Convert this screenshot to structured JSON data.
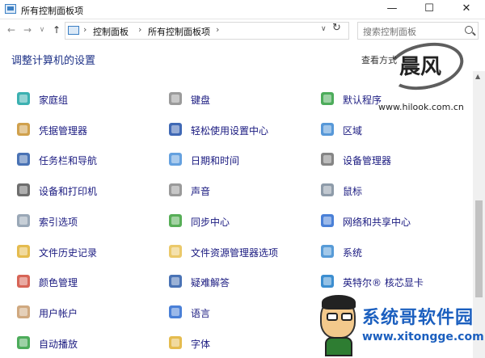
{
  "window": {
    "title": "所有控制面板项",
    "minimize_glyph": "—",
    "maximize_glyph": "☐",
    "close_glyph": "✕"
  },
  "nav": {
    "back_glyph": "←",
    "forward_glyph": "→",
    "recent_glyph": "∨",
    "up_glyph": "↑"
  },
  "address": {
    "crumbs": [
      "控制面板",
      "所有控制面板项"
    ],
    "separator": "›",
    "dropdown_glyph": "∨",
    "refresh_glyph": "↻"
  },
  "search": {
    "placeholder": "搜索控制面板"
  },
  "heading": "调整计算机的设置",
  "view_by": "查看方式",
  "items": [
    {
      "label": "家庭组",
      "icon": "homegroup-icon",
      "color": "#1aa3a3"
    },
    {
      "label": "键盘",
      "icon": "keyboard-icon",
      "color": "#8a8a8a"
    },
    {
      "label": "默认程序",
      "icon": "default-programs-icon",
      "color": "#2e9e3e"
    },
    {
      "label": "凭据管理器",
      "icon": "credential-manager-icon",
      "color": "#c8902e"
    },
    {
      "label": "轻松使用设置中心",
      "icon": "ease-of-access-icon",
      "color": "#1f4fa8"
    },
    {
      "label": "区域",
      "icon": "region-icon",
      "color": "#3a86d1"
    },
    {
      "label": "任务栏和导航",
      "icon": "taskbar-icon",
      "color": "#2a5aa8"
    },
    {
      "label": "日期和时间",
      "icon": "date-time-icon",
      "color": "#4a90d9"
    },
    {
      "label": "设备管理器",
      "icon": "device-manager-icon",
      "color": "#707070"
    },
    {
      "label": "设备和打印机",
      "icon": "printer-icon",
      "color": "#555555"
    },
    {
      "label": "声音",
      "icon": "sound-icon",
      "color": "#888888"
    },
    {
      "label": "鼠标",
      "icon": "mouse-icon",
      "color": "#7a8a9a"
    },
    {
      "label": "索引选项",
      "icon": "indexing-icon",
      "color": "#8899aa"
    },
    {
      "label": "同步中心",
      "icon": "sync-center-icon",
      "color": "#3aa03a"
    },
    {
      "label": "网络和共享中心",
      "icon": "network-icon",
      "color": "#2a6ad0"
    },
    {
      "label": "文件历史记录",
      "icon": "file-history-icon",
      "color": "#e0b030"
    },
    {
      "label": "文件资源管理器选项",
      "icon": "folder-options-icon",
      "color": "#e8c050"
    },
    {
      "label": "系统",
      "icon": "system-icon",
      "color": "#3a8ad0"
    },
    {
      "label": "颜色管理",
      "icon": "color-management-icon",
      "color": "#d04a3a"
    },
    {
      "label": "疑难解答",
      "icon": "troubleshooting-icon",
      "color": "#2a5aa8"
    },
    {
      "label": "英特尔® 核芯显卡",
      "icon": "intel-graphics-icon",
      "color": "#1a7ac8"
    },
    {
      "label": "用户帐户",
      "icon": "user-accounts-icon",
      "color": "#c89a6a"
    },
    {
      "label": "语言",
      "icon": "language-icon",
      "color": "#2a6ad0"
    },
    {
      "label": "",
      "icon": "blank-icon",
      "color": "#ffffff"
    },
    {
      "label": "自动播放",
      "icon": "autoplay-icon",
      "color": "#2e9e3e"
    },
    {
      "label": "字体",
      "icon": "fonts-icon",
      "color": "#e0b030"
    }
  ],
  "watermark_top": {
    "glyph": "晨风",
    "url": "www.hilook.com.cn"
  },
  "watermark_bottom": {
    "name": "系统哥软件园",
    "url": "www.xitongge.com"
  },
  "scrollbar": {
    "up_glyph": "▲"
  }
}
